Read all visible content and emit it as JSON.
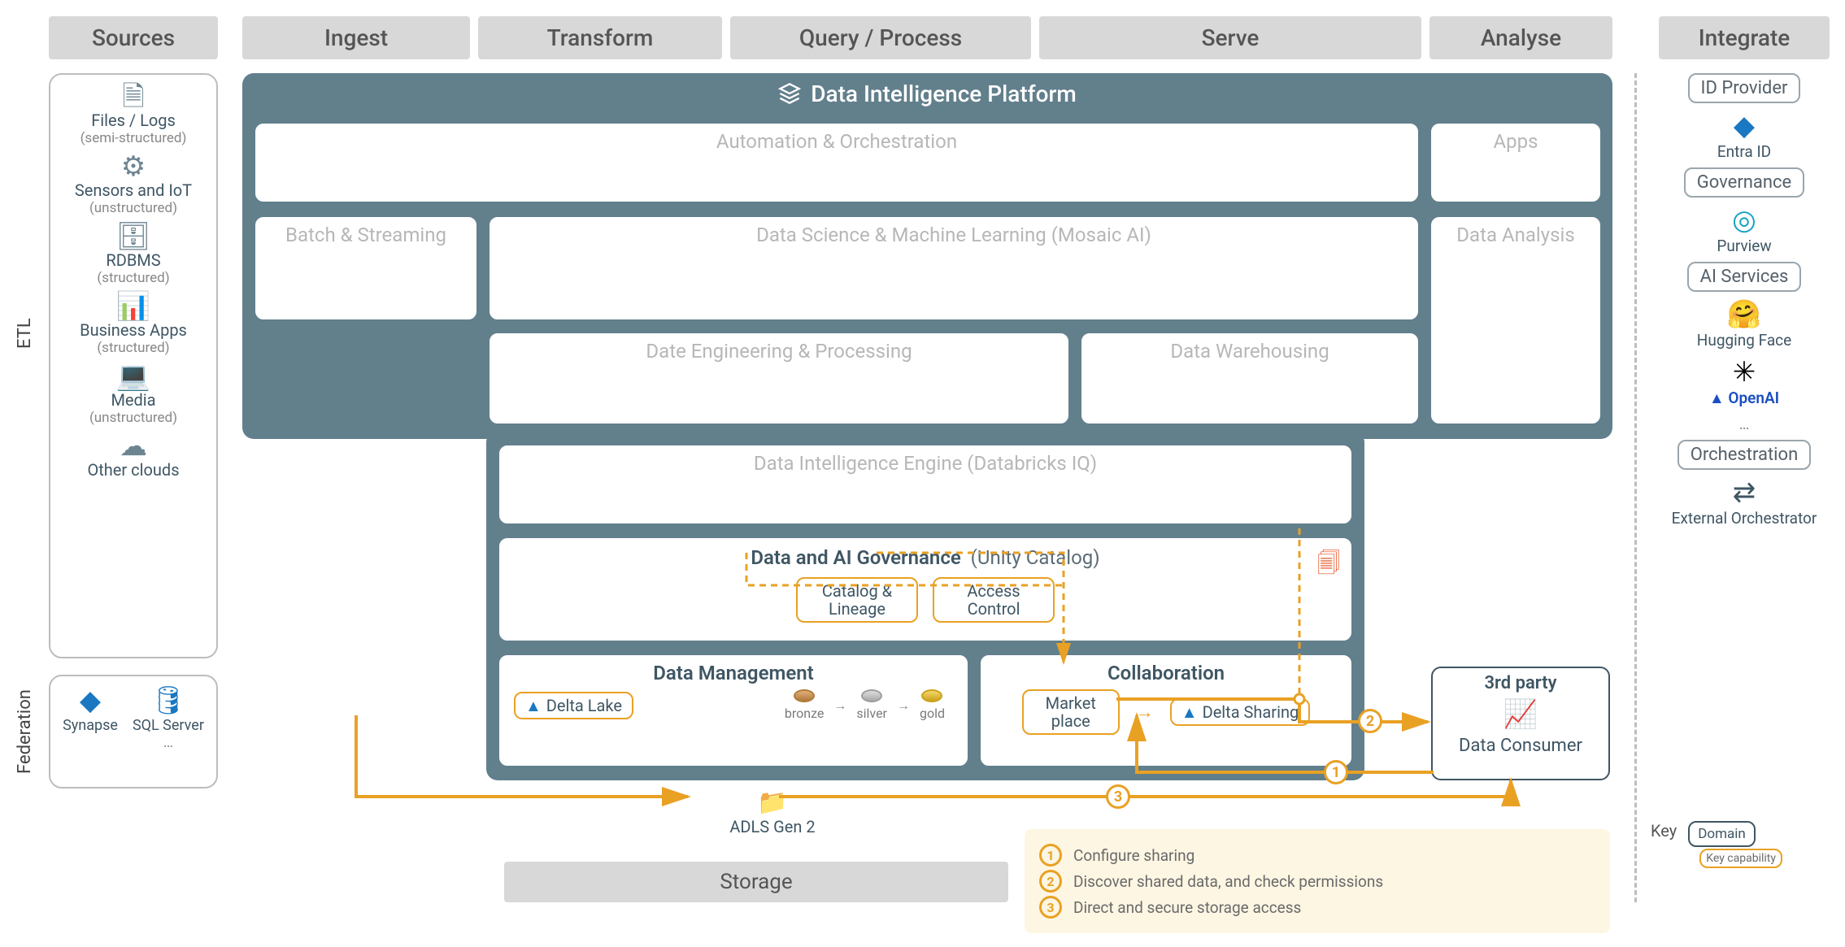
{
  "columns": {
    "sources": "Sources",
    "ingest": "Ingest",
    "transform": "Transform",
    "query": "Query / Process",
    "serve": "Serve",
    "analyse": "Analyse",
    "integrate": "Integrate"
  },
  "vertical": {
    "etl": "ETL",
    "federation": "Federation"
  },
  "sources": {
    "files": {
      "title": "Files / Logs",
      "sub": "(semi-structured)"
    },
    "iot": {
      "title": "Sensors and IoT",
      "sub": "(unstructured)"
    },
    "rdbms": {
      "title": "RDBMS",
      "sub": "(structured)"
    },
    "biz": {
      "title": "Business Apps",
      "sub": "(structured)"
    },
    "media": {
      "title": "Media",
      "sub": "(unstructured)"
    },
    "clouds": {
      "title": "Other clouds"
    }
  },
  "federation": {
    "synapse": "Synapse",
    "sqlserver": "SQL Server",
    "more": "…"
  },
  "platform": {
    "title": "Data Intelligence Platform",
    "automation": "Automation & Orchestration",
    "apps": "Apps",
    "batch": "Batch & Streaming",
    "dsml": "Data Science & Machine Learning  (Mosaic AI)",
    "analysis": "Data Analysis",
    "de": "Date Engineering & Processing",
    "dw": "Data Warehousing",
    "engine": "Data Intelligence Engine  (Databricks IQ)",
    "gov": {
      "main": "Data and AI Governance",
      "sub": "(Unity Catalog)",
      "catalog": "Catalog & Lineage",
      "access": "Access Control"
    },
    "dm": {
      "title": "Data Management",
      "delta": "Delta Lake",
      "bronze": "bronze",
      "silver": "silver",
      "gold": "gold"
    },
    "collab": {
      "title": "Collaboration",
      "market": "Market place",
      "sharing": "Delta Sharing"
    }
  },
  "third_party": {
    "title": "3rd party",
    "consumer": "Data Consumer"
  },
  "storage": {
    "adls": "ADLS Gen 2",
    "label": "Storage"
  },
  "steps": {
    "s1": "Configure sharing",
    "s2": "Discover shared data, and check permissions",
    "s3": "Direct and secure storage access"
  },
  "integrate": {
    "idp": "ID Provider",
    "entra": "Entra ID",
    "gov": "Governance",
    "purview": "Purview",
    "ai": "AI Services",
    "hf": "Hugging Face",
    "openai": "OpenAI",
    "more": "…",
    "orch": "Orchestration",
    "ext": "External Orchestrator"
  },
  "legend": {
    "key": "Key",
    "domain": "Domain",
    "cap": "Key capability"
  }
}
